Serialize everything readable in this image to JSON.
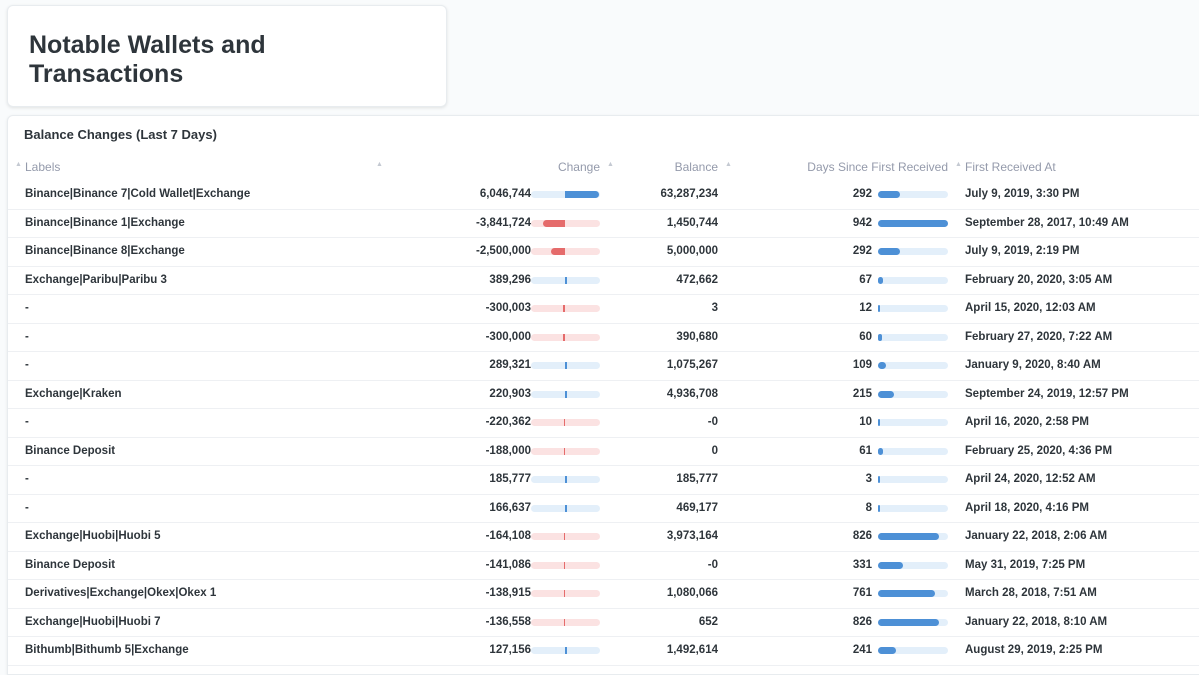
{
  "page": {
    "title": "Notable Wallets and Transactions"
  },
  "table": {
    "title": "Balance Changes (Last 7 Days)",
    "columns": {
      "labels": "Labels",
      "change": "Change",
      "balance": "Balance",
      "days": "Days Since First Received",
      "first_received": "First Received At"
    },
    "colors": {
      "positive": "#4d90d6",
      "negative": "#e56b6b"
    },
    "rows": [
      {
        "label": "Binance|Binance 7|Cold Wallet|Exchange",
        "change": "6,046,744",
        "change_value": 6046744,
        "balance": "63,287,234",
        "days": "292",
        "days_value": 292,
        "first_received": "July 9, 2019, 3:30 PM"
      },
      {
        "label": "Binance|Binance 1|Exchange",
        "change": "-3,841,724",
        "change_value": -3841724,
        "balance": "1,450,744",
        "days": "942",
        "days_value": 942,
        "first_received": "September 28, 2017, 10:49 AM"
      },
      {
        "label": "Binance|Binance 8|Exchange",
        "change": "-2,500,000",
        "change_value": -2500000,
        "balance": "5,000,000",
        "days": "292",
        "days_value": 292,
        "first_received": "July 9, 2019, 2:19 PM"
      },
      {
        "label": "Exchange|Paribu|Paribu 3",
        "change": "389,296",
        "change_value": 389296,
        "balance": "472,662",
        "days": "67",
        "days_value": 67,
        "first_received": "February 20, 2020, 3:05 AM"
      },
      {
        "label": "-",
        "change": "-300,003",
        "change_value": -300003,
        "balance": "3",
        "days": "12",
        "days_value": 12,
        "first_received": "April 15, 2020, 12:03 AM"
      },
      {
        "label": "-",
        "change": "-300,000",
        "change_value": -300000,
        "balance": "390,680",
        "days": "60",
        "days_value": 60,
        "first_received": "February 27, 2020, 7:22 AM"
      },
      {
        "label": "-",
        "change": "289,321",
        "change_value": 289321,
        "balance": "1,075,267",
        "days": "109",
        "days_value": 109,
        "first_received": "January 9, 2020, 8:40 AM"
      },
      {
        "label": "Exchange|Kraken",
        "change": "220,903",
        "change_value": 220903,
        "balance": "4,936,708",
        "days": "215",
        "days_value": 215,
        "first_received": "September 24, 2019, 12:57 PM"
      },
      {
        "label": "-",
        "change": "-220,362",
        "change_value": -220362,
        "balance": "-0",
        "days": "10",
        "days_value": 10,
        "first_received": "April 16, 2020, 2:58 PM"
      },
      {
        "label": "Binance Deposit",
        "change": "-188,000",
        "change_value": -188000,
        "balance": "0",
        "days": "61",
        "days_value": 61,
        "first_received": "February 25, 2020, 4:36 PM"
      },
      {
        "label": "-",
        "change": "185,777",
        "change_value": 185777,
        "balance": "185,777",
        "days": "3",
        "days_value": 3,
        "first_received": "April 24, 2020, 12:52 AM"
      },
      {
        "label": "-",
        "change": "166,637",
        "change_value": 166637,
        "balance": "469,177",
        "days": "8",
        "days_value": 8,
        "first_received": "April 18, 2020, 4:16 PM"
      },
      {
        "label": "Exchange|Huobi|Huobi 5",
        "change": "-164,108",
        "change_value": -164108,
        "balance": "3,973,164",
        "days": "826",
        "days_value": 826,
        "first_received": "January 22, 2018, 2:06 AM"
      },
      {
        "label": "Binance Deposit",
        "change": "-141,086",
        "change_value": -141086,
        "balance": "-0",
        "days": "331",
        "days_value": 331,
        "first_received": "May 31, 2019, 7:25 PM"
      },
      {
        "label": "Derivatives|Exchange|Okex|Okex 1",
        "change": "-138,915",
        "change_value": -138915,
        "balance": "1,080,066",
        "days": "761",
        "days_value": 761,
        "first_received": "March 28, 2018, 7:51 AM"
      },
      {
        "label": "Exchange|Huobi|Huobi 7",
        "change": "-136,558",
        "change_value": -136558,
        "balance": "652",
        "days": "826",
        "days_value": 826,
        "first_received": "January 22, 2018, 8:10 AM"
      },
      {
        "label": "Bithumb|Bithumb 5|Exchange",
        "change": "127,156",
        "change_value": 127156,
        "balance": "1,492,614",
        "days": "241",
        "days_value": 241,
        "first_received": "August 29, 2019, 2:25 PM"
      }
    ]
  }
}
